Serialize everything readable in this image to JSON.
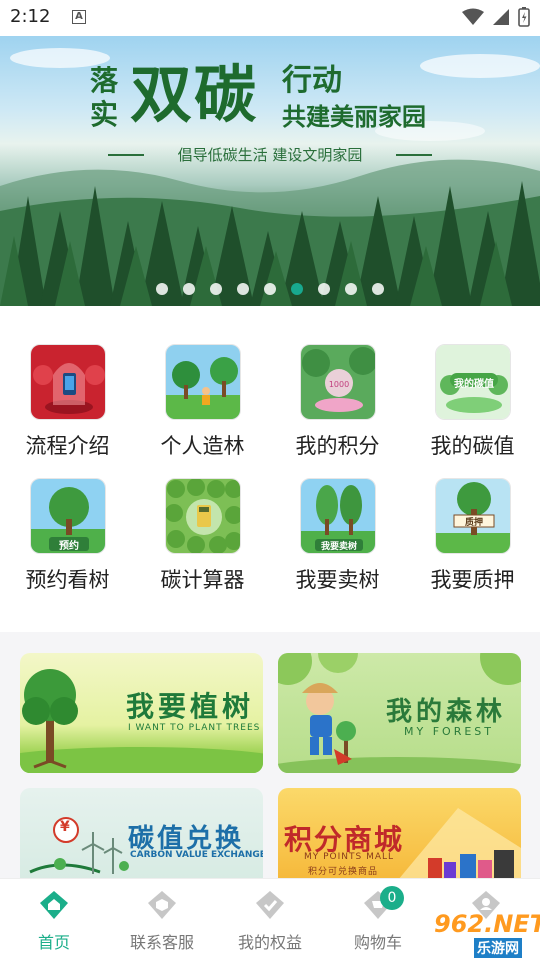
{
  "status_bar": {
    "time": "2:12",
    "indicator": "A"
  },
  "banner": {
    "title_side": "落\n实",
    "title_main": "双碳",
    "title_r1": "行动",
    "title_r2": "共建美丽家园",
    "subtitle": "倡导低碳生活   建设文明家园",
    "dot_count": 9,
    "active_dot": 5
  },
  "grid": [
    {
      "label": "流程介绍",
      "icon": "phone-in-dome-icon"
    },
    {
      "label": "个人造林",
      "icon": "planting-tree-icon"
    },
    {
      "label": "我的积分",
      "icon": "points-pedestal-icon"
    },
    {
      "label": "我的碳值",
      "icon": "carbon-value-icon",
      "caption": "我的碳值"
    },
    {
      "label": "预约看树",
      "icon": "reserve-tree-icon",
      "caption": "预约"
    },
    {
      "label": "碳计算器",
      "icon": "calculator-icon"
    },
    {
      "label": "我要卖树",
      "icon": "sell-tree-icon",
      "caption": "我要卖树"
    },
    {
      "label": "我要质押",
      "icon": "pledge-tree-icon",
      "caption": "质押"
    }
  ],
  "cards": {
    "plant": {
      "title": "我要植树",
      "subtitle": "I WANT TO PLANT TREES"
    },
    "forest": {
      "title": "我的森林",
      "subtitle": "MY FOREST"
    },
    "exchange": {
      "title": "碳值兑换",
      "subtitle": "CARBON VALUE EXCHANGE",
      "currency": "¥"
    },
    "mall": {
      "title": "积分商城",
      "subtitle": "MY POINTS MALL",
      "note": "积分可兑换商品"
    }
  },
  "nav": [
    {
      "label": "首页",
      "active": true
    },
    {
      "label": "联系客服",
      "active": false
    },
    {
      "label": "我的权益",
      "active": false
    },
    {
      "label": "购物车",
      "active": false
    },
    {
      "label": "",
      "active": false
    }
  ],
  "cart_badge": "0",
  "watermark": {
    "main": "962.NET",
    "sub": "乐游网"
  },
  "colors": {
    "accent": "#1bae8a",
    "banner_text": "#1e6b2e"
  }
}
